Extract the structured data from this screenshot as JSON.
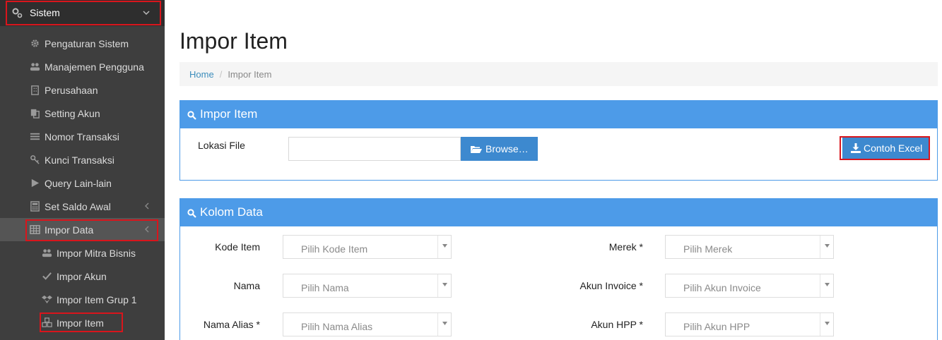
{
  "sidebar": {
    "header": {
      "label": "Sistem",
      "icon": "gears-icon"
    },
    "items": [
      {
        "label": "Pengaturan Sistem",
        "icon": "gear-icon"
      },
      {
        "label": "Manajemen Pengguna",
        "icon": "users-icon"
      },
      {
        "label": "Perusahaan",
        "icon": "building-icon"
      },
      {
        "label": "Setting Akun",
        "icon": "copy-icon"
      },
      {
        "label": "Nomor Transaksi",
        "icon": "list-icon"
      },
      {
        "label": "Kunci Transaksi",
        "icon": "key-icon"
      },
      {
        "label": "Query Lain-lain",
        "icon": "play-icon"
      },
      {
        "label": "Set Saldo Awal",
        "icon": "calculator-icon"
      },
      {
        "label": "Impor Data",
        "icon": "table-icon"
      }
    ],
    "subitems": [
      {
        "label": "Impor Mitra Bisnis",
        "icon": "users-icon"
      },
      {
        "label": "Impor Akun",
        "icon": "check-icon"
      },
      {
        "label": "Impor Item Grup 1",
        "icon": "dropbox-icon"
      },
      {
        "label": "Impor Item",
        "icon": "cubes-icon"
      }
    ]
  },
  "page": {
    "title": "Impor Item",
    "breadcrumb": {
      "home": "Home",
      "current": "Impor Item"
    }
  },
  "import_panel": {
    "title": "Impor Item",
    "file_label": "Lokasi File",
    "file_value": "",
    "browse_label": "Browse…",
    "sample_label": "Contoh Excel"
  },
  "columns_panel": {
    "title": "Kolom Data",
    "fields": [
      {
        "label": "Kode Item",
        "placeholder": "Pilih Kode Item"
      },
      {
        "label": "Nama",
        "placeholder": "Pilih Nama"
      },
      {
        "label": "Nama Alias *",
        "placeholder": "Pilih Nama Alias"
      },
      {
        "label": "Merek *",
        "placeholder": "Pilih Merek"
      },
      {
        "label": "Akun Invoice *",
        "placeholder": "Pilih Akun Invoice"
      },
      {
        "label": "Akun HPP *",
        "placeholder": "Pilih Akun HPP"
      }
    ]
  },
  "colors": {
    "sidebar_bg": "#3e3e3e",
    "panel_header": "#4d9be8",
    "button": "#3d89cf",
    "highlight": "#d9151c",
    "link": "#3c8dbc"
  }
}
